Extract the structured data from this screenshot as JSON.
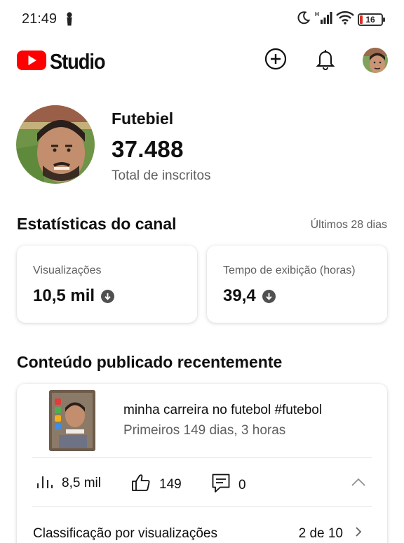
{
  "status_bar": {
    "time": "21:49",
    "battery": "16",
    "icons": [
      "person-icon",
      "moon-icon",
      "signal-icon",
      "wifi-icon",
      "battery-icon"
    ]
  },
  "header": {
    "app_name": "Studio",
    "icons": [
      "youtube-logo",
      "add-icon",
      "bell-icon",
      "avatar"
    ]
  },
  "channel": {
    "name": "Futebiel",
    "subscribers": "37.488",
    "subscribers_label": "Total de inscritos"
  },
  "stats": {
    "title": "Estatísticas do canal",
    "period": "Últimos 28 dias",
    "cards": [
      {
        "label": "Visualizações",
        "value": "10,5 mil",
        "trend": "down"
      },
      {
        "label": "Tempo de exibição (horas)",
        "value": "39,4",
        "trend": "down"
      }
    ]
  },
  "recent": {
    "title": "Conteúdo publicado recentemente",
    "video": {
      "title": "minha carreira no futebol #futebol",
      "subtitle": "Primeiros 149 dias, 3 horas",
      "views": "8,5 mil",
      "likes": "149",
      "comments": "0",
      "rank_label": "Classificação por visualizações",
      "rank_value": "2 de 10"
    }
  },
  "colors": {
    "youtube_red": "#ff0000",
    "text_primary": "#0f0f0f",
    "text_secondary": "#606060",
    "battery_low": "#d93025"
  }
}
